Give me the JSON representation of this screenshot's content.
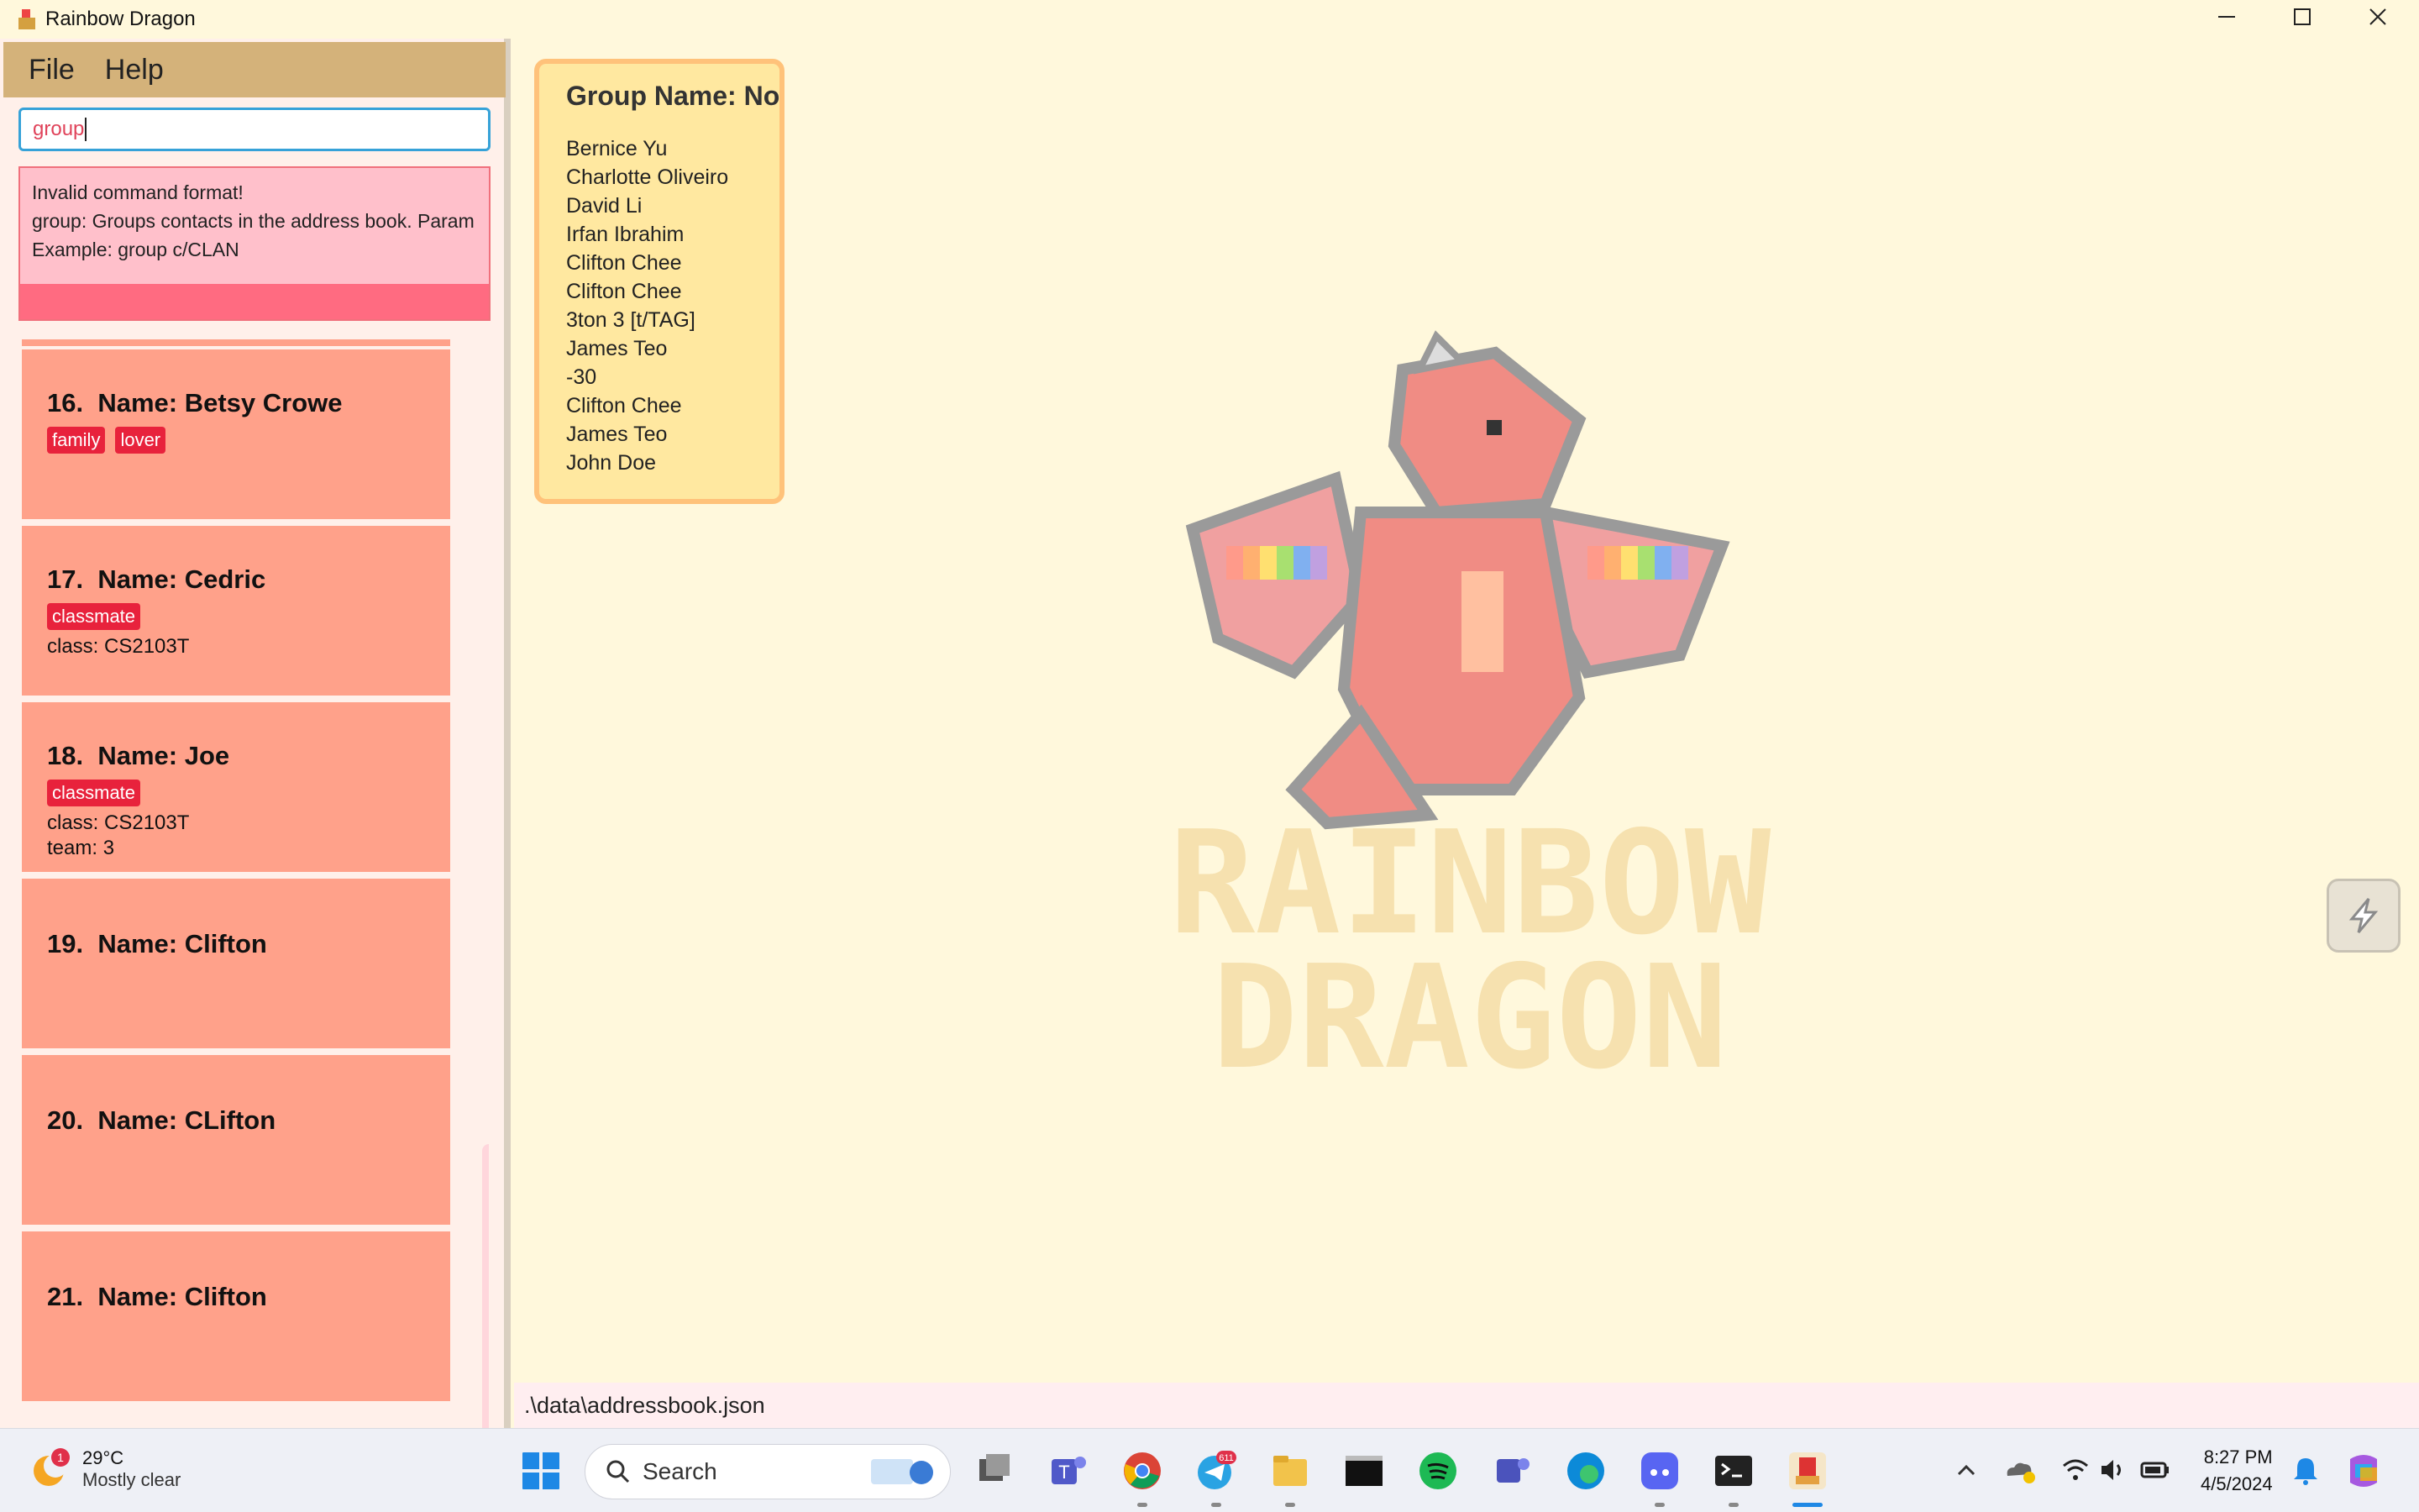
{
  "window": {
    "title": "Rainbow Dragon"
  },
  "menu": {
    "file": "File",
    "help": "Help"
  },
  "command": {
    "value": "group"
  },
  "result": {
    "line1": "Invalid command format!",
    "line2": "group: Groups contacts in the address book. Param",
    "line3": "Example: group c/CLAN"
  },
  "cards": [
    {
      "index": "16.",
      "name": "Name: Betsy Crowe",
      "tags": [
        "family",
        "lover"
      ]
    },
    {
      "index": "17.",
      "name": "Name: Cedric",
      "tags": [
        "classmate"
      ],
      "class": "class: CS2103T"
    },
    {
      "index": "18.",
      "name": "Name: Joe",
      "tags": [
        "classmate"
      ],
      "class": "class: CS2103T",
      "team": "team: 3"
    },
    {
      "index": "19.",
      "name": "Name: Clifton"
    },
    {
      "index": "20.",
      "name": "Name: CLifton"
    },
    {
      "index": "21.",
      "name": "Name: Clifton"
    }
  ],
  "group": {
    "name": "Group Name: No",
    "members": [
      "Bernice Yu",
      "Charlotte Oliveiro",
      "David Li",
      "Irfan Ibrahim",
      "Clifton Chee",
      "Clifton Chee",
      "3ton 3 [t/TAG]",
      "James Teo",
      "-30",
      "Clifton Chee",
      "James Teo",
      "John Doe"
    ]
  },
  "logo": {
    "line1": "RAINBOW",
    "line2": "DRAGON"
  },
  "status": {
    "path": ".\\data\\addressbook.json"
  },
  "taskbar": {
    "weather_temp": "29°C",
    "weather_desc": "Mostly clear",
    "weather_badge": "1",
    "search": "Search",
    "telegram_badge": "611",
    "time": "8:27 PM",
    "date": "4/5/2024"
  }
}
